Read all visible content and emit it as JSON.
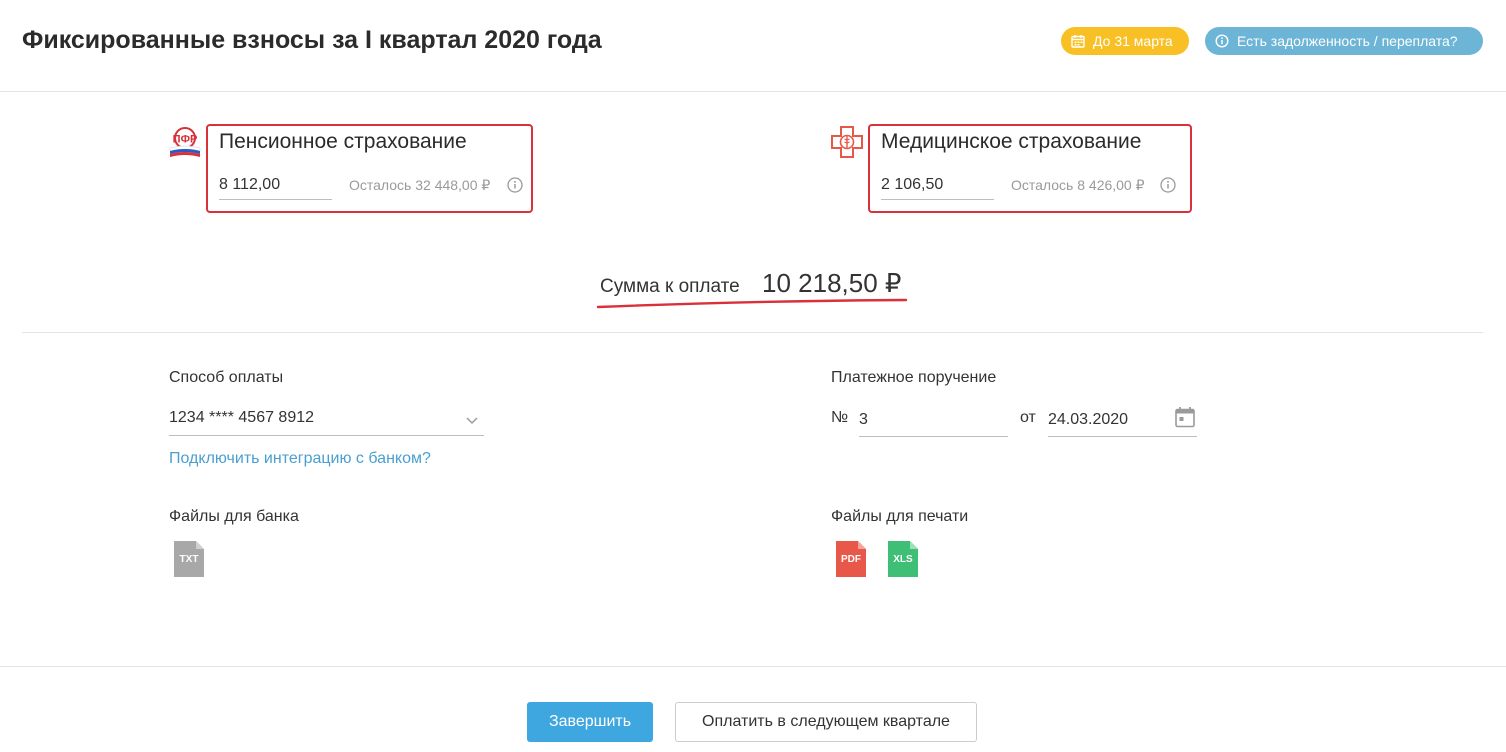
{
  "header": {
    "title": "Фиксированные взносы за I квартал 2020 года",
    "deadline_badge": "До 31 марта",
    "debt_button": "Есть задолженность / переплата?"
  },
  "pension": {
    "title": "Пенсионное страхование",
    "amount": "8 112,00",
    "remaining": "Осталось 32 448,00 ₽",
    "icon": "pfr-logo-icon"
  },
  "medical": {
    "title": "Медицинское страхование",
    "amount": "2 106,50",
    "remaining": "Осталось 8 426,00 ₽",
    "icon": "medical-cross-icon"
  },
  "sum": {
    "label": "Сумма к оплате",
    "value": "10 218,50 ₽"
  },
  "payment": {
    "label": "Способ оплаты",
    "selected": "1234 **** 4567 8912",
    "bank_link": "Подключить интеграцию с банком?"
  },
  "order": {
    "label": "Платежное поручение",
    "number_prefix": "№",
    "number": "3",
    "date_prefix": "от",
    "date": "24.03.2020"
  },
  "bank_files": {
    "label": "Файлы для банка",
    "txt": "TXT"
  },
  "print_files": {
    "label": "Файлы для печати",
    "pdf": "PDF",
    "xls": "XLS"
  },
  "footer": {
    "finish_button": "Завершить",
    "next_quarter_button": "Оплатить в следующем квартале"
  },
  "colors": {
    "accent": "#3ea7e0",
    "badge_yellow": "#f8c024",
    "badge_blue": "#6cb5d6",
    "highlight_red": "#d9303a",
    "pdf_red": "#e8584a",
    "xls_green": "#3fbf75",
    "txt_grey": "#a8a8a8"
  }
}
